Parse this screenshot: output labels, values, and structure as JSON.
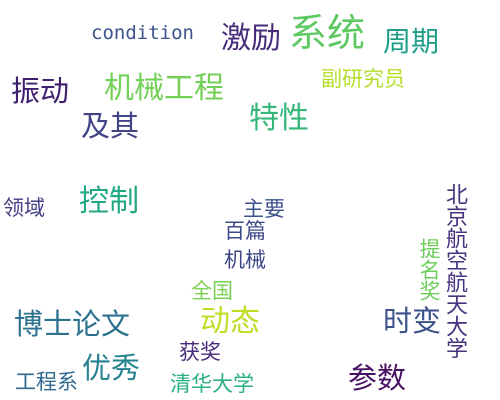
{
  "words": [
    {
      "text": "condition",
      "color": "#3b528b"
    },
    {
      "text": "激励",
      "color": "#472c7a"
    },
    {
      "text": "系统",
      "color": "#5ec962"
    },
    {
      "text": "周期",
      "color": "#1f9e89"
    },
    {
      "text": "振动",
      "color": "#3e1f6e"
    },
    {
      "text": "机械工程",
      "color": "#73d056"
    },
    {
      "text": "副研究员",
      "color": "#b5de2b"
    },
    {
      "text": "及其",
      "color": "#414487"
    },
    {
      "text": "特性",
      "color": "#35b779"
    },
    {
      "text": "控制",
      "color": "#22a884"
    },
    {
      "text": "领域",
      "color": "#433e85"
    },
    {
      "text": "主要",
      "color": "#3b528b"
    },
    {
      "text": "百篇",
      "color": "#3e4a89"
    },
    {
      "text": "北京航空航天大学",
      "color": "#46337e"
    },
    {
      "text": "机械",
      "color": "#3f4889"
    },
    {
      "text": "提名奖",
      "color": "#6ccd5a"
    },
    {
      "text": "全国",
      "color": "#7ad151"
    },
    {
      "text": "博士论文",
      "color": "#2c728e"
    },
    {
      "text": "动态",
      "color": "#bddf26"
    },
    {
      "text": "时变",
      "color": "#3b528b"
    },
    {
      "text": "获奖",
      "color": "#482878"
    },
    {
      "text": "优秀",
      "color": "#26828e"
    },
    {
      "text": "工程系",
      "color": "#31688e"
    },
    {
      "text": "清华大学",
      "color": "#2ab07f"
    },
    {
      "text": "参数",
      "color": "#471164"
    }
  ]
}
